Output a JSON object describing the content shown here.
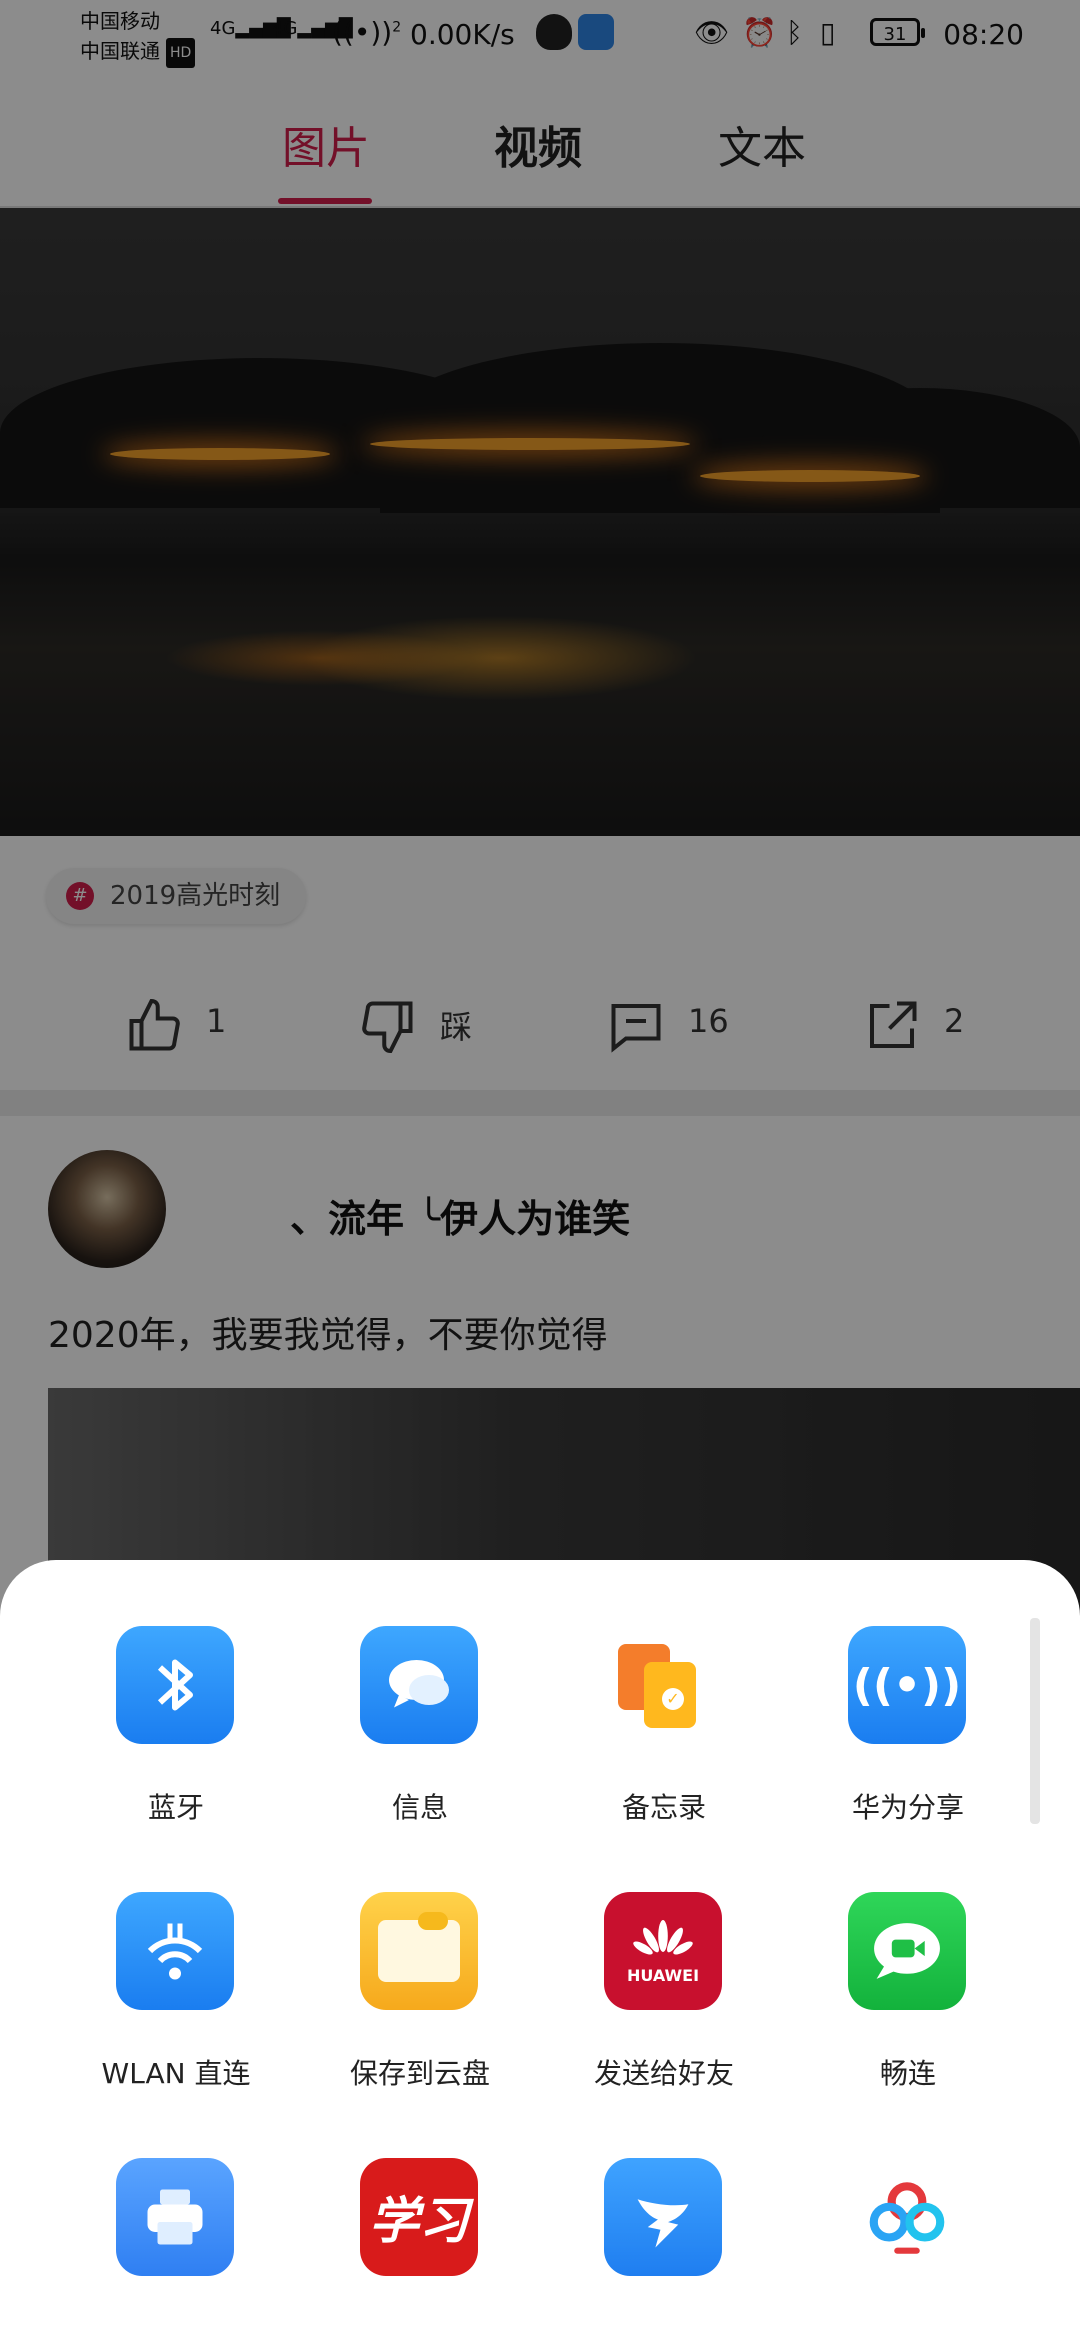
{
  "status_bar": {
    "carrier1": "中国移动",
    "carrier2": "中国联通",
    "hd": "HD",
    "net1": "4G",
    "net2": "4G",
    "hotspot_count": "2",
    "speed": "0.00K/s",
    "battery": "31",
    "time": "08:20"
  },
  "tabs": [
    {
      "label": "图片"
    },
    {
      "label": "视频"
    },
    {
      "label": "文本"
    }
  ],
  "tag": "2019高光时刻",
  "tag_icon": "#",
  "actions": {
    "like": "1",
    "dislike": "踩",
    "comment": "16",
    "share": "2"
  },
  "post": {
    "username": "、流年 ╰伊人为谁笑",
    "text": "2020年，我要我觉得，不要你觉得"
  },
  "share_sheet": {
    "items": [
      {
        "label": "蓝牙",
        "icon": "bluetooth-icon",
        "color": "#2b8ef3"
      },
      {
        "label": "信息",
        "icon": "message-icon",
        "color": "#2b8ef3"
      },
      {
        "label": "备忘录",
        "icon": "notepad-icon",
        "color": "#ffffff"
      },
      {
        "label": "华为分享",
        "icon": "huawei-share-icon",
        "color": "#2b8ef3"
      },
      {
        "label": "WLAN 直连",
        "icon": "wlan-direct-icon",
        "color": "#2b8ef3"
      },
      {
        "label": "保存到云盘",
        "icon": "cloud-folder-icon",
        "color": "#f6b91c"
      },
      {
        "label": "发送给好友",
        "icon": "huawei-logo-icon",
        "color": "#c8102e",
        "logo_text": "HUAWEI"
      },
      {
        "label": "畅连",
        "icon": "video-call-icon",
        "color": "#1fbf46"
      },
      {
        "label": "",
        "icon": "printer-icon",
        "color": "#3d8bf5"
      },
      {
        "label": "",
        "icon": "xuexi-icon",
        "color": "#d81b1b",
        "logo_text": "学习"
      },
      {
        "label": "",
        "icon": "dingtalk-icon",
        "color": "#2a8cf2"
      },
      {
        "label": "",
        "icon": "baidu-netdisk-icon",
        "color": "#ffffff"
      }
    ]
  }
}
